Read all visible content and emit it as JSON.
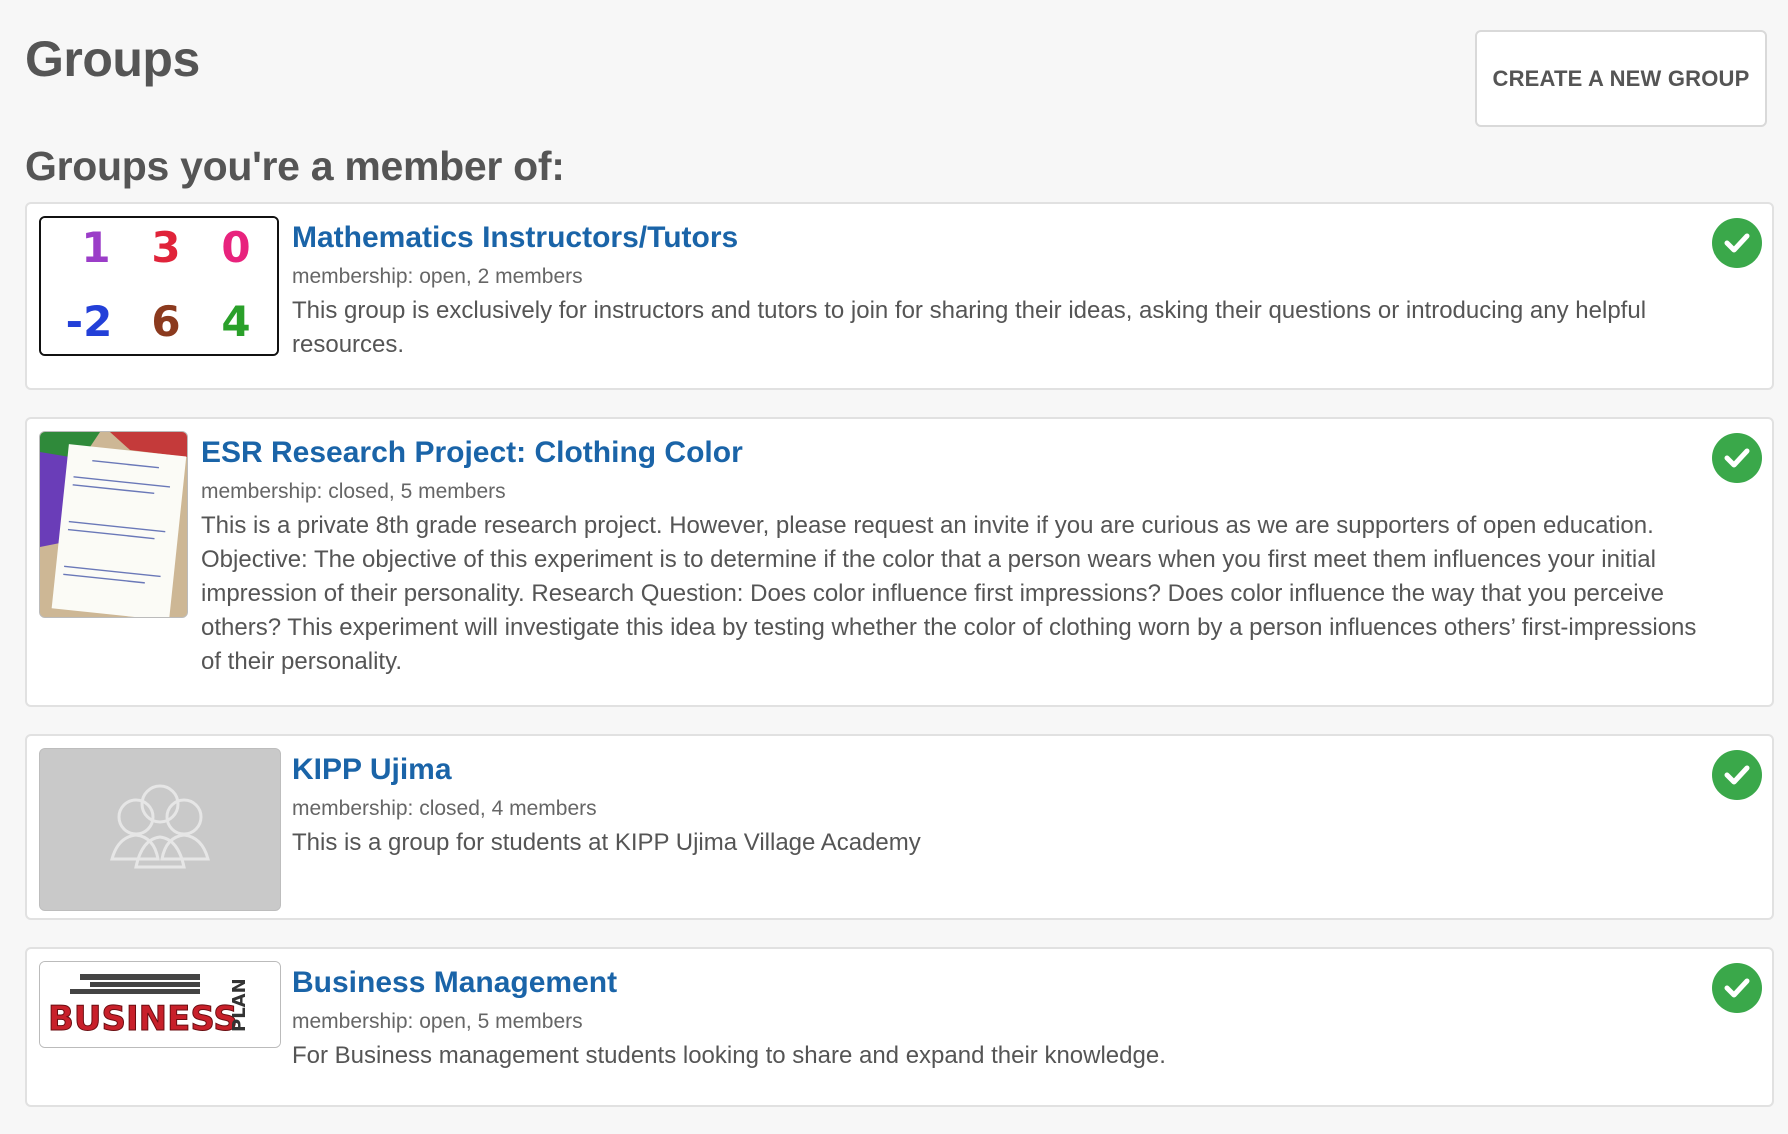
{
  "page": {
    "title": "Groups",
    "create_button": "CREATE A NEW GROUP",
    "section_title": "Groups you're a member of:"
  },
  "groups": [
    {
      "title": "Mathematics Instructors/Tutors",
      "meta": "membership: open, 2 members",
      "description": "This group is exclusively for instructors and tutors to join for sharing their ideas, asking their questions or introducing any helpful resources.",
      "thumb_numbers": [
        "1",
        "3",
        "0",
        "-2",
        "6",
        "4"
      ],
      "thumb_colors": [
        "#9b3dc8",
        "#e0243a",
        "#e8237d",
        "#2340d8",
        "#8b3a1e",
        "#2aa02a"
      ]
    },
    {
      "title": "ESR Research Project: Clothing Color",
      "meta": "membership: closed, 5 members",
      "description": "This is a private 8th grade research project. However, please request an invite if you are curious as we are supporters of open education.  Objective: The objective of this experiment is to determine if the color that a person wears when you first meet them influences your initial impression of their personality.  Research Question: Does color influence first impressions? Does color influence the way that you perceive others? This experiment will investigate this idea by testing whether the color of clothing worn by a person influences others’ first-impressions of their personality."
    },
    {
      "title": "KIPP Ujima",
      "meta": "membership: closed, 4 members",
      "description": "This is a group for students at KIPP Ujima Village Academy"
    },
    {
      "title": "Business Management",
      "meta": "membership: open, 5 members",
      "description": "For Business management students looking to share and expand their knowledge.",
      "thumb_word": "BUSINESS",
      "thumb_side_word": "PLAN"
    }
  ],
  "colors": {
    "link": "#1a64a8",
    "check": "#3aa84a",
    "background": "#f7f7f7"
  },
  "icons": {
    "membership_status": "check-circle-icon",
    "placeholder": "group-people-icon"
  }
}
